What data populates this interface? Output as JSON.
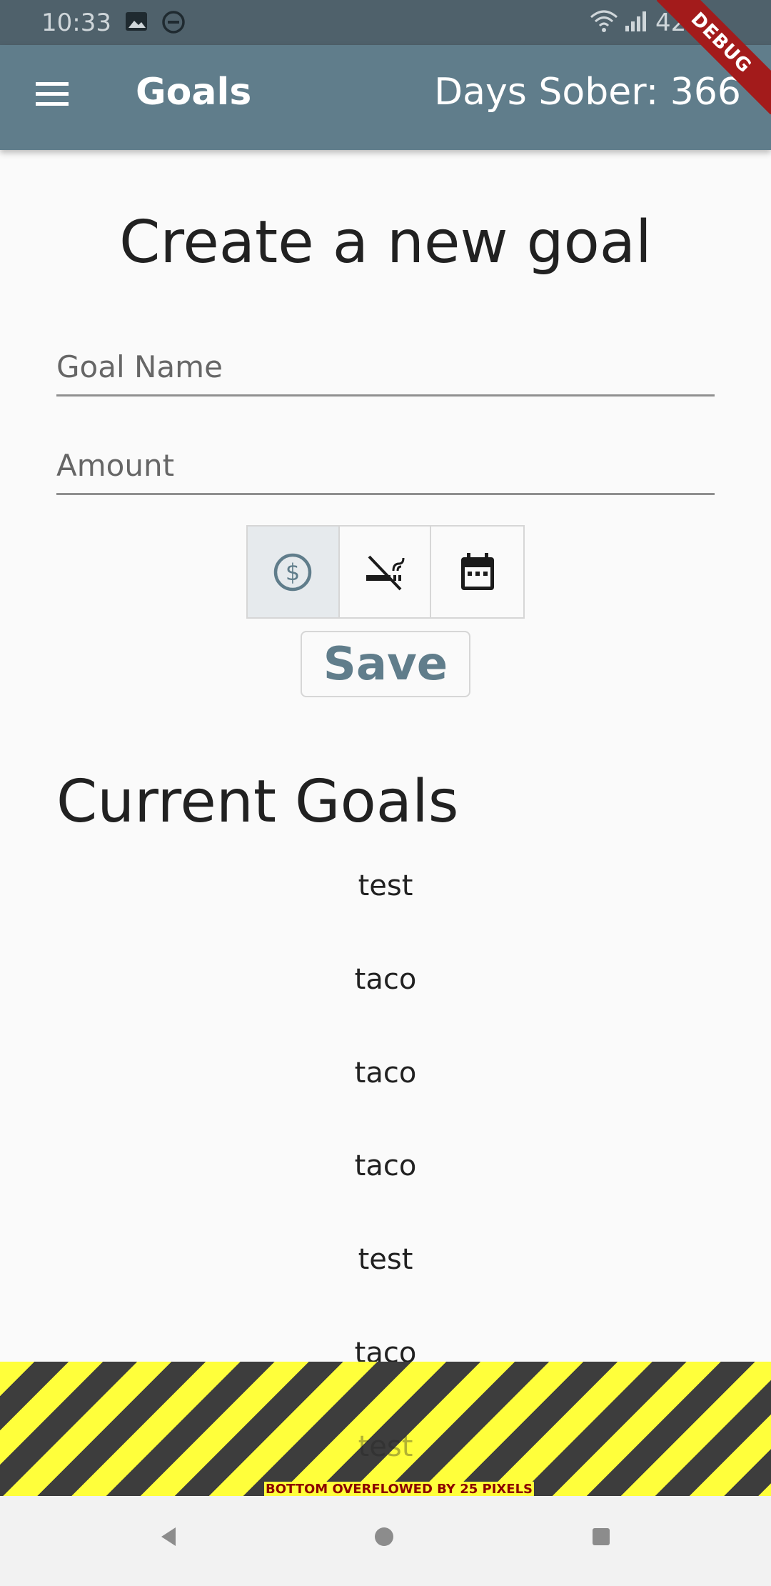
{
  "status_bar": {
    "time": "10:33",
    "battery": "42"
  },
  "app_bar": {
    "title": "Goals",
    "days_sober": "Days Sober: 366"
  },
  "debug_banner": "DEBUG",
  "create_form": {
    "heading": "Create a new goal",
    "goal_name_placeholder": "Goal Name",
    "amount_placeholder": "Amount",
    "type_toggles": [
      {
        "icon": "dollar-circle-icon",
        "selected": true
      },
      {
        "icon": "no-smoking-icon",
        "selected": false
      },
      {
        "icon": "calendar-icon",
        "selected": false
      }
    ],
    "save_label": "Save"
  },
  "current_goals": {
    "heading": "Current Goals",
    "items": [
      "test",
      "taco",
      "taco",
      "taco",
      "test",
      "taco",
      "test"
    ]
  },
  "overflow_warning": "BOTTOM OVERFLOWED BY 25 PIXELS",
  "colors": {
    "primary": "#607d8b",
    "status_bar": "#4f616b",
    "debug": "#a31b1b"
  }
}
